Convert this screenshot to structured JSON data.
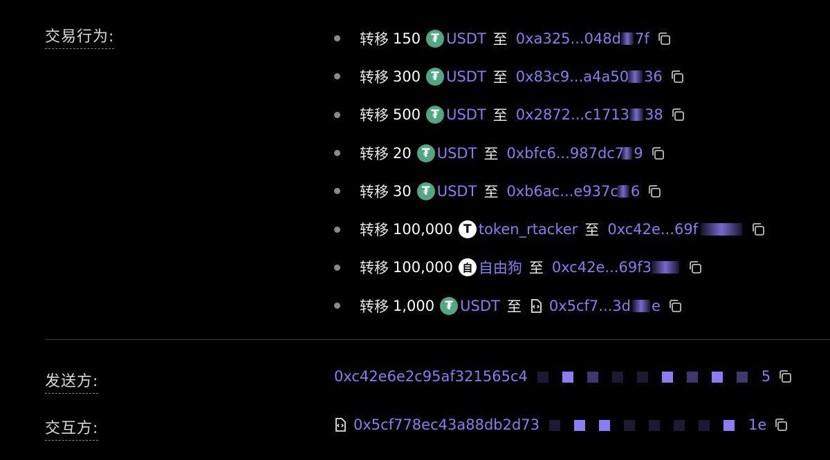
{
  "labels": {
    "actions": "交易行为:",
    "sender": "发送方:",
    "interactor": "交互方:"
  },
  "transfers": [
    {
      "verb": "转移",
      "amount": "150",
      "token": "USDT",
      "token_icon": "usdt-icon",
      "to": "至",
      "addr_start": "0xa325...048d",
      "addr_end": "7f"
    },
    {
      "verb": "转移",
      "amount": "300",
      "token": "USDT",
      "token_icon": "usdt-icon",
      "to": "至",
      "addr_start": "0x83c9...a4a50",
      "addr_end": "36"
    },
    {
      "verb": "转移",
      "amount": "500",
      "token": "USDT",
      "token_icon": "usdt-icon",
      "to": "至",
      "addr_start": "0x2872...c1713",
      "addr_end": "38"
    },
    {
      "verb": "转移",
      "amount": "20",
      "token": "USDT",
      "token_icon": "usdt-icon",
      "to": "至",
      "addr_start": "0xbfc6...987dc7",
      "addr_end": "9"
    },
    {
      "verb": "转移",
      "amount": "30",
      "token": "USDT",
      "token_icon": "usdt-icon",
      "to": "至",
      "addr_start": "0xb6ac...e937c",
      "addr_end": "6"
    },
    {
      "verb": "转移",
      "amount": "100,000",
      "token": "token_rtacker",
      "token_icon": "t-icon",
      "icon_glyph": "T",
      "to": "至",
      "addr_start": "0xc42e...69f",
      "addr_end": ""
    },
    {
      "verb": "转移",
      "amount": "100,000",
      "token": "自由狗",
      "token_icon": "zi-icon",
      "icon_glyph": "自",
      "to": "至",
      "addr_start": "0xc42e...69f3",
      "addr_end": ""
    },
    {
      "verb": "转移",
      "amount": "1,000",
      "token": "USDT",
      "token_icon": "usdt-icon",
      "to": "至",
      "addr_start": "0x5cf7...3d",
      "addr_end": "e",
      "contract": true
    }
  ],
  "sender": {
    "addr_start": "0xc42e6e2c95af321565c4",
    "addr_end": "5"
  },
  "interactor": {
    "addr_start": "0x5cf778ec43a88db2d73",
    "addr_end": "1e"
  },
  "colors": {
    "accent": "#8a7cf5",
    "usdt": "#4fa882",
    "background": "#000000"
  }
}
